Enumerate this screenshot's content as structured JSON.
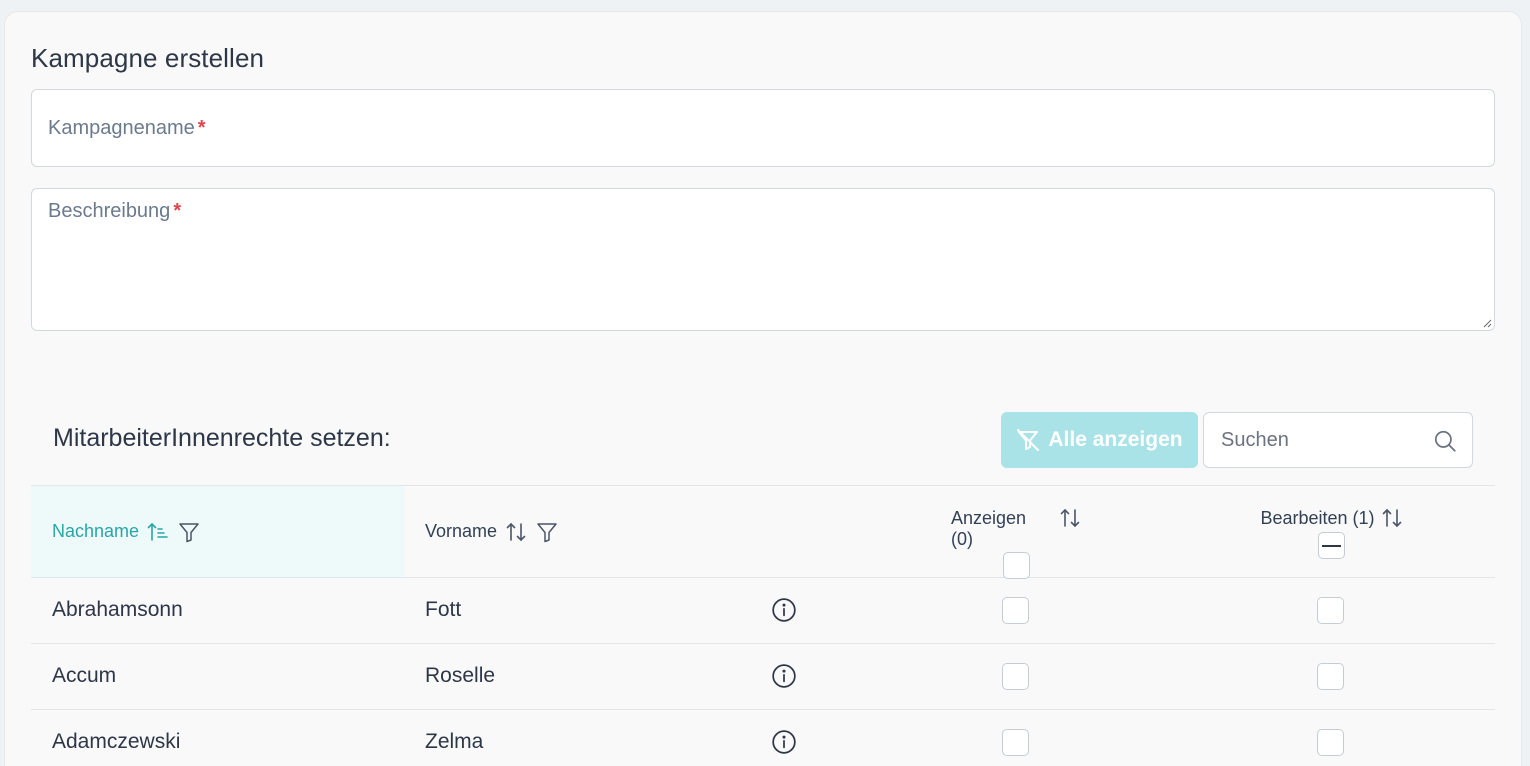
{
  "page": {
    "title": "Kampagne erstellen"
  },
  "form": {
    "name_label": "Kampagnename",
    "description_label": "Beschreibung",
    "required_marker": "*"
  },
  "permissions": {
    "title": "MitarbeiterInnenrechte setzen:",
    "show_all_label": "Alle anzeigen",
    "search_placeholder": "Suchen",
    "columns": {
      "last_name": "Nachname",
      "first_name": "Vorname",
      "view": "Anzeigen (0)",
      "edit": "Bearbeiten (1)"
    },
    "rows": [
      {
        "last_name": "Abrahamsonn",
        "first_name": "Fott"
      },
      {
        "last_name": "Accum",
        "first_name": "Roselle"
      },
      {
        "last_name": "Adamczewski",
        "first_name": "Zelma"
      }
    ]
  },
  "colors": {
    "accent": "#2aa6a8",
    "button_bg": "#a9e3e8",
    "required": "#e0434b"
  }
}
